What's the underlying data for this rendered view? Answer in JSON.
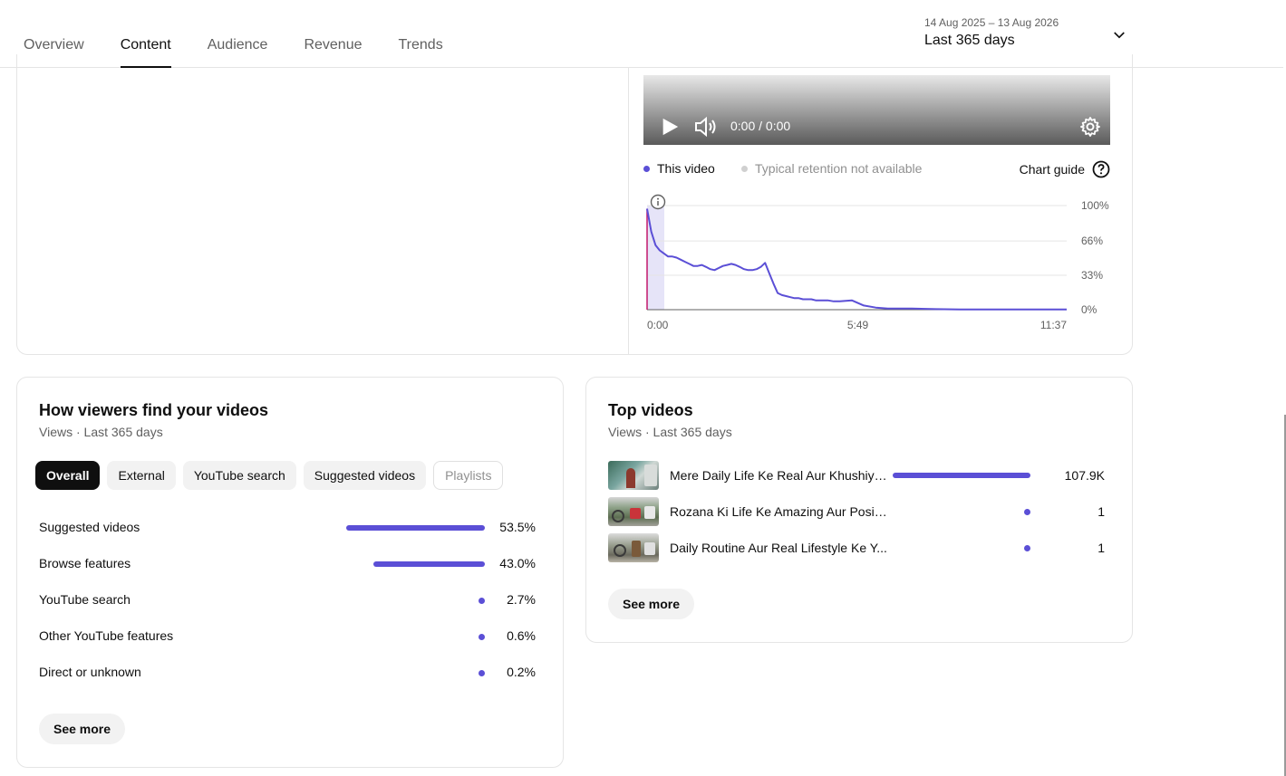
{
  "header": {
    "tabs": [
      {
        "label": "Overview"
      },
      {
        "label": "Content"
      },
      {
        "label": "Audience"
      },
      {
        "label": "Revenue"
      },
      {
        "label": "Trends"
      }
    ],
    "active_tab": "Content",
    "date_range": {
      "sub": "14 Aug 2025 – 13 Aug 2026",
      "main": "Last 365 days"
    }
  },
  "retention": {
    "player": {
      "time": "0:00 / 0:00"
    },
    "legend": {
      "this_video": "This video",
      "typical": "Typical retention not available",
      "chart_guide": "Chart guide"
    },
    "colors": {
      "series": "#5b4fd6",
      "typical": "#d0d0d0",
      "highlight": "#e6e4f8",
      "start_line": "#c2186b"
    },
    "chart_data": {
      "type": "line",
      "x_ticks": [
        "0:00",
        "5:49",
        "11:37"
      ],
      "y_ticks": [
        "100%",
        "66%",
        "33%",
        "0%"
      ],
      "xlim": [
        0,
        697
      ],
      "ylim": [
        0,
        100
      ],
      "series": [
        {
          "name": "This video",
          "x": [
            0,
            7,
            14,
            21,
            28,
            35,
            42,
            49,
            56,
            63,
            70,
            77,
            84,
            91,
            98,
            105,
            112,
            119,
            126,
            133,
            140,
            147,
            154,
            161,
            168,
            175,
            182,
            189,
            196,
            203,
            210,
            217,
            224,
            231,
            238,
            245,
            252,
            259,
            266,
            273,
            280,
            290,
            300,
            310,
            320,
            340,
            360,
            380,
            400,
            440,
            480,
            520,
            560,
            600,
            640,
            697
          ],
          "y": [
            97,
            75,
            62,
            57,
            54,
            51,
            51,
            50,
            48,
            46,
            44,
            42,
            42,
            43,
            41,
            39,
            38,
            40,
            42,
            43,
            44,
            43,
            41,
            39,
            38,
            38,
            39,
            41,
            45,
            35,
            25,
            16,
            14,
            13,
            12,
            11,
            11,
            10,
            10,
            10,
            9,
            9,
            9,
            8,
            8,
            9,
            4,
            2,
            1,
            1,
            0.5,
            0.3,
            0.2,
            0.2,
            0.2,
            0.2
          ]
        }
      ]
    }
  },
  "traffic": {
    "title": "How viewers find your videos",
    "subtitle": "Views · Last 365 days",
    "chips": [
      "Overall",
      "External",
      "YouTube search",
      "Suggested videos",
      "Playlists"
    ],
    "rows": [
      {
        "label": "Suggested videos",
        "value": "53.5%",
        "fraction": 0.535
      },
      {
        "label": "Browse features",
        "value": "43.0%",
        "fraction": 0.43
      },
      {
        "label": "YouTube search",
        "value": "2.7%",
        "fraction": 0.027
      },
      {
        "label": "Other YouTube features",
        "value": "0.6%",
        "fraction": 0.006
      },
      {
        "label": "Direct or unknown",
        "value": "0.2%",
        "fraction": 0.002
      }
    ],
    "see_more": "See more"
  },
  "top_videos": {
    "title": "Top videos",
    "subtitle": "Views · Last 365 days",
    "rows": [
      {
        "title": "Mere Daily Life Ke Real Aur Khushiyo...",
        "value": "107.9K",
        "fraction": 1.0
      },
      {
        "title": "Rozana Ki Life Ke Amazing Aur Posit...",
        "value": "1",
        "fraction": 1e-05
      },
      {
        "title": "Daily Routine Aur Real Lifestyle Ke Y...",
        "value": "1",
        "fraction": 1e-05
      }
    ],
    "see_more": "See more"
  }
}
